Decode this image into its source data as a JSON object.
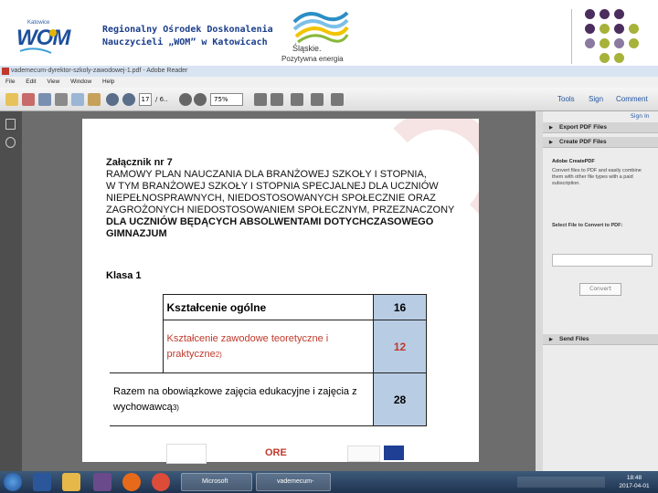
{
  "slide": {
    "logo_small": "Katowice",
    "logo_text": "WOM",
    "title_line1": "Regionalny Ośrodek Doskonalenia",
    "title_line2": "Nauczycieli „WOM” w Katowicach",
    "region_name": "Śląskie.",
    "region_tagline": "Pozytywna energia"
  },
  "window": {
    "title": "vademecum-dyrektor-szkoly-zawodowej-1.pdf - Adobe Reader",
    "menu": [
      "File",
      "Edit",
      "View",
      "Window",
      "Help"
    ],
    "toolbar": {
      "page_current": "17",
      "page_total": "/ 6..",
      "zoom": "75%",
      "tools_label": "Tools",
      "sign_label": "Sign",
      "comment_label": "Comment"
    }
  },
  "document": {
    "line1": "Załącznik nr 7",
    "line2": "RAMOWY PLAN NAUCZANIA DLA BRANŻOWEJ SZKOŁY I STOPNIA,",
    "line3": "W TYM BRANŻOWEJ SZKOŁY I STOPNIA SPECJALNEJ DLA UCZNIÓW",
    "line4": "NIEPEŁNOSPRAWNYCH, NIEDOSTOSOWANYCH SPOŁECZNIE ORAZ",
    "line5": "ZAGROŻONYCH NIEDOSTOSOWANIEM SPOŁECZNYM, PRZEZNACZONY",
    "line6": "DLA UCZNIÓW BĘDĄCYCH ABSOLWENTAMI DOTYCHCZASOWEGO",
    "line7": "GIMNAZJUM",
    "klasa": "Klasa 1",
    "rows": [
      {
        "label": "Kształcenie ogólne",
        "value": "16"
      },
      {
        "label": "Kształcenie zawodowe teoretyczne i praktyczne",
        "footnote": "2)",
        "value": "12"
      },
      {
        "label": "Razem na obowiązkowe zajęcia edukacyjne i zajęcia z wychowawcą",
        "footnote": "3)",
        "value": "28"
      }
    ],
    "footer_logo": "ORE"
  },
  "right_pane": {
    "signin": "Sign In",
    "export_pdf": "Export PDF Files",
    "create_pdf": "Create PDF Files",
    "createpdf_title": "Adobe CreatePDF",
    "createpdf_desc": "Convert files to PDF and easily combine them with other file types with a paid subscription.",
    "select_file": "Select File to Convert to PDF:",
    "convert_btn": "Convert",
    "send_files": "Send Files"
  },
  "taskbar": {
    "task1": "Microsoft PowerP...",
    "task2": "vademecum-dyre...",
    "time": "18:48",
    "date": "2017-04-01"
  },
  "colors": {
    "title_blue": "#1a3d8a",
    "table_cell": "#b8cce4",
    "accent_red": "#c0392b"
  }
}
